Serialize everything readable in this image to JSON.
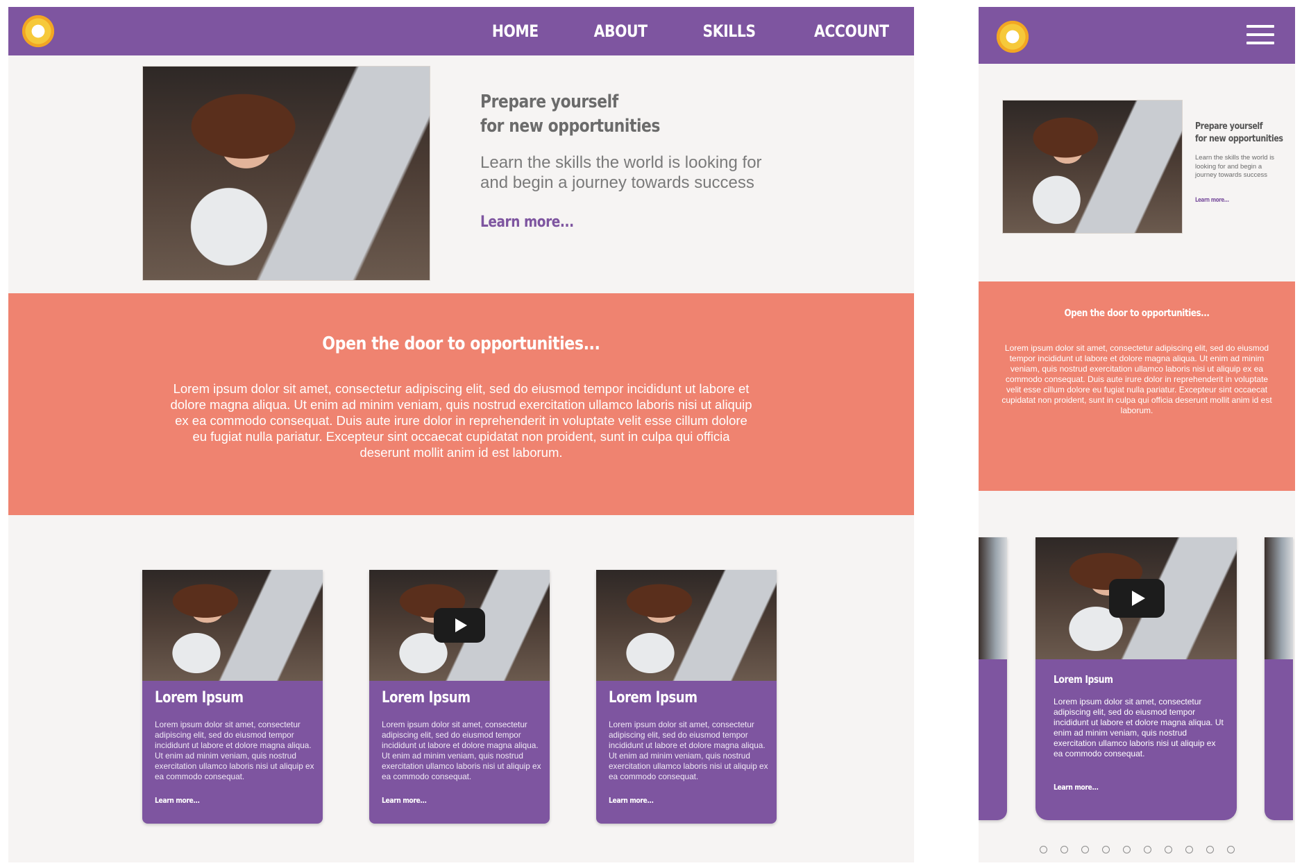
{
  "colors": {
    "nav_purple": "#7e55a0",
    "band_salmon": "#ef8370",
    "page_bg": "#f6f4f3",
    "logo_yellow": "#f6c93a"
  },
  "desktop": {
    "logo_icon": "sun-logo-icon",
    "nav": [
      "HOME",
      "ABOUT",
      "SKILLS",
      "ACCOUNT"
    ],
    "hero": {
      "title_line1": "Prepare yourself",
      "title_line2": "for new opportunities",
      "subtitle": "Learn the skills the world is looking for and begin a journey towards success",
      "link": "Learn more..."
    },
    "band": {
      "heading": "Open the door to opportunities...",
      "body": "Lorem ipsum dolor sit amet, consectetur adipiscing elit, sed do eiusmod tempor incididunt ut labore et dolore magna aliqua. Ut enim ad minim veniam, quis nostrud exercitation ullamco laboris nisi ut aliquip ex ea commodo consequat. Duis aute irure dolor in reprehenderit in voluptate velit esse cillum dolore eu fugiat nulla pariatur. Excepteur sint occaecat cupidatat non proident, sunt in culpa qui officia deserunt mollit anim id est laborum."
    },
    "cards": [
      {
        "title": "Lorem Ipsum",
        "body": "Lorem ipsum dolor sit amet, consectetur adipiscing elit, sed do eiusmod tempor incididunt ut labore et dolore magna aliqua. Ut enim ad minim veniam, quis nostrud exercitation ullamco laboris nisi ut aliquip ex ea commodo consequat.",
        "link": "Learn more..."
      },
      {
        "title": "Lorem Ipsum",
        "body": "Lorem ipsum dolor sit amet, consectetur adipiscing elit, sed do eiusmod tempor incididunt ut labore et dolore magna aliqua. Ut enim ad minim veniam, quis nostrud exercitation ullamco laboris nisi ut aliquip ex ea commodo consequat.",
        "link": "Learn more..."
      },
      {
        "title": "Lorem Ipsum",
        "body": "Lorem ipsum dolor sit amet, consectetur adipiscing elit, sed do eiusmod tempor incididunt ut labore et dolore magna aliqua. Ut enim ad minim veniam, quis nostrud exercitation ullamco laboris nisi ut aliquip ex ea commodo consequat.",
        "link": "Learn more..."
      }
    ]
  },
  "mobile": {
    "logo_icon": "sun-logo-icon",
    "menu_icon": "hamburger-menu-icon",
    "hero": {
      "title_line1": "Prepare yourself",
      "title_line2": "for new opportunities",
      "subtitle": "Learn the skills the world is looking for and begin a journey towards success",
      "link": "Learn more..."
    },
    "band": {
      "heading": "Open the door to opportunities...",
      "body": "Lorem ipsum dolor sit amet, consectetur adipiscing elit, sed do eiusmod tempor incididunt ut labore et dolore magna aliqua. Ut enim ad minim veniam, quis nostrud exercitation ullamco laboris nisi ut aliquip ex ea commodo consequat. Duis aute irure dolor in reprehenderit in voluptate velit esse cillum dolore eu fugiat nulla pariatur. Excepteur sint occaecat cupidatat non proident, sunt in culpa qui officia deserunt mollit anim id est laborum."
    },
    "card": {
      "title": "Lorem Ipsum",
      "body": "Lorem ipsum dolor sit amet, consectetur adipiscing elit, sed do eiusmod tempor incididunt ut labore et dolore magna aliqua. Ut enim ad minim veniam, quis nostrud exercitation ullamco laboris nisi ut aliquip ex ea commodo consequat.",
      "link": "Learn more..."
    },
    "carousel_dot_count": 10
  }
}
